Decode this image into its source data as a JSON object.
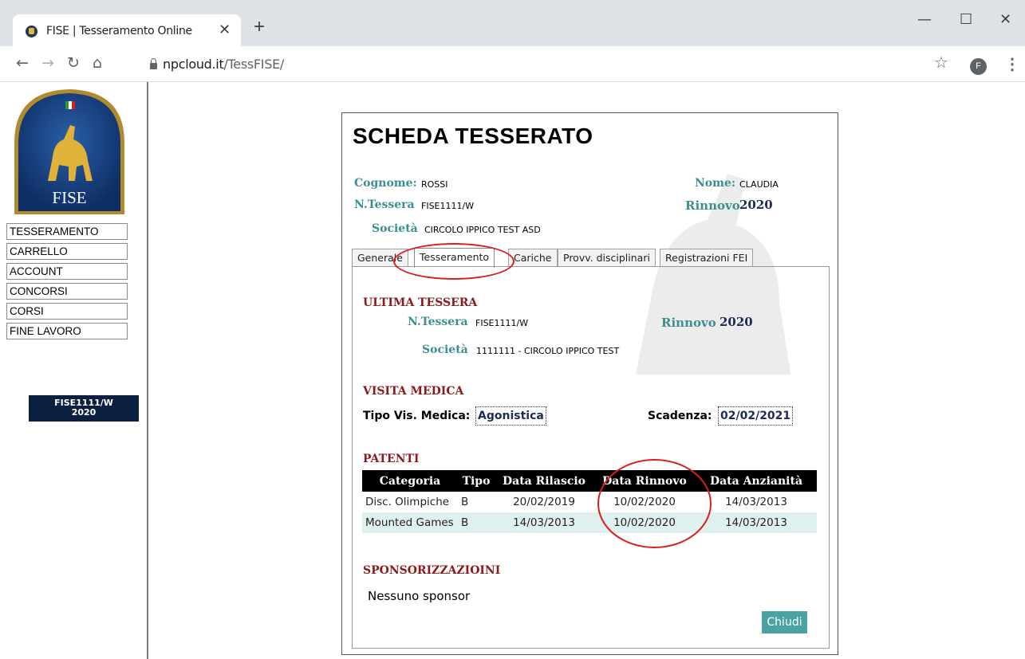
{
  "browser": {
    "tab_title": "FISE | Tesseramento Online",
    "url_host": "npcloud.it",
    "url_path": "/TessFISE/",
    "profile_initial": "F"
  },
  "sidebar": {
    "logo_text": "FISE",
    "menu": [
      "TESSERAMENTO",
      "CARRELLO",
      "ACCOUNT",
      "CONCORSI",
      "CORSI",
      "FINE LAVORO"
    ],
    "badge_line1": "FISE1111/W",
    "badge_line2": "2020"
  },
  "card": {
    "title": "SCHEDA TESSERATO",
    "cognome_label": "Cognome:",
    "cognome": "ROSSI",
    "nome_label": "Nome:",
    "nome": "CLAUDIA",
    "tessera_label": "N.Tessera",
    "tessera": "FISE1111/W",
    "rinnovo_label": "Rinnovo",
    "rinnovo": "2020",
    "societa_label": "Società",
    "societa": "CIRCOLO IPPICO TEST ASD"
  },
  "tabs": [
    "Generale",
    "Tesseramento",
    "Cariche",
    "Provv. disciplinari",
    "Registrazioni FEI"
  ],
  "active_tab": "Tesseramento",
  "ultima_tessera": {
    "title": "ULTIMA TESSERA",
    "tessera_label": "N.Tessera",
    "tessera": "FISE1111/W",
    "rinnovo_label": "Rinnovo",
    "rinnovo": "2020",
    "societa_label": "Società",
    "societa": "1111111 - CIRCOLO IPPICO TEST"
  },
  "visita_medica": {
    "title": "VISITA MEDICA",
    "tipo_label": "Tipo Vis. Medica:",
    "tipo": "Agonistica",
    "scadenza_label": "Scadenza:",
    "scadenza": "02/02/2021"
  },
  "patenti": {
    "title": "PATENTI",
    "columns": [
      "Categoria",
      "Tipo",
      "Data Rilascio",
      "Data Rinnovo",
      "Data Anzianità"
    ],
    "rows": [
      [
        "Disc. Olimpiche",
        "B",
        "20/02/2019",
        "10/02/2020",
        "14/03/2013"
      ],
      [
        "Mounted Games",
        "B",
        "14/03/2013",
        "10/02/2020",
        "14/03/2013"
      ]
    ]
  },
  "sponsorizzazioni": {
    "title": "SPONSORIZZAZIOINI",
    "empty_text": "Nessuno sponsor"
  },
  "close_label": "Chiudi",
  "colors": {
    "accent_teal": "#3d8f8f",
    "section_red": "#8b1a1a",
    "badge_navy": "#0b2040",
    "highlight_circle": "#d81e1e"
  }
}
